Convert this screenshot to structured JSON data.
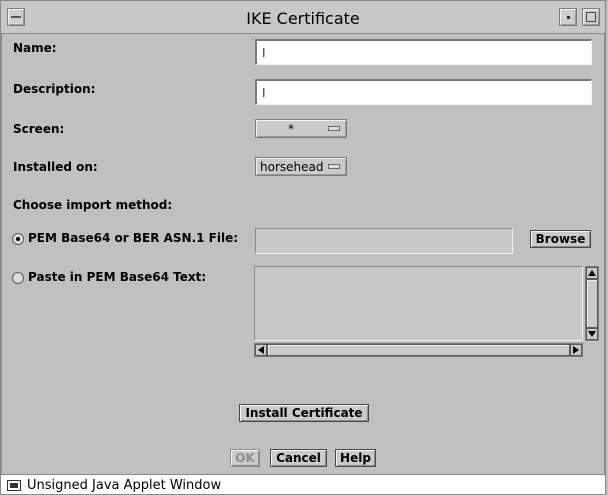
{
  "window": {
    "title": "IKE Certificate"
  },
  "form": {
    "name_label": "Name:",
    "name_value": "",
    "description_label": "Description:",
    "description_value": "",
    "screen_label": "Screen:",
    "screen_value": "*",
    "installed_on_label": "Installed on:",
    "installed_on_value": "horsehead",
    "import_method_label": "Choose import method:",
    "option_file_label": "PEM Base64 or BER ASN.1 File:",
    "option_file_selected": true,
    "browse_label": "Browse",
    "option_paste_label": "Paste in PEM Base64 Text:",
    "paste_text": "",
    "install_label": "Install Certificate"
  },
  "footer": {
    "ok_label": "OK",
    "cancel_label": "Cancel",
    "help_label": "Help"
  },
  "status": {
    "text": "Unsigned Java Applet Window"
  }
}
